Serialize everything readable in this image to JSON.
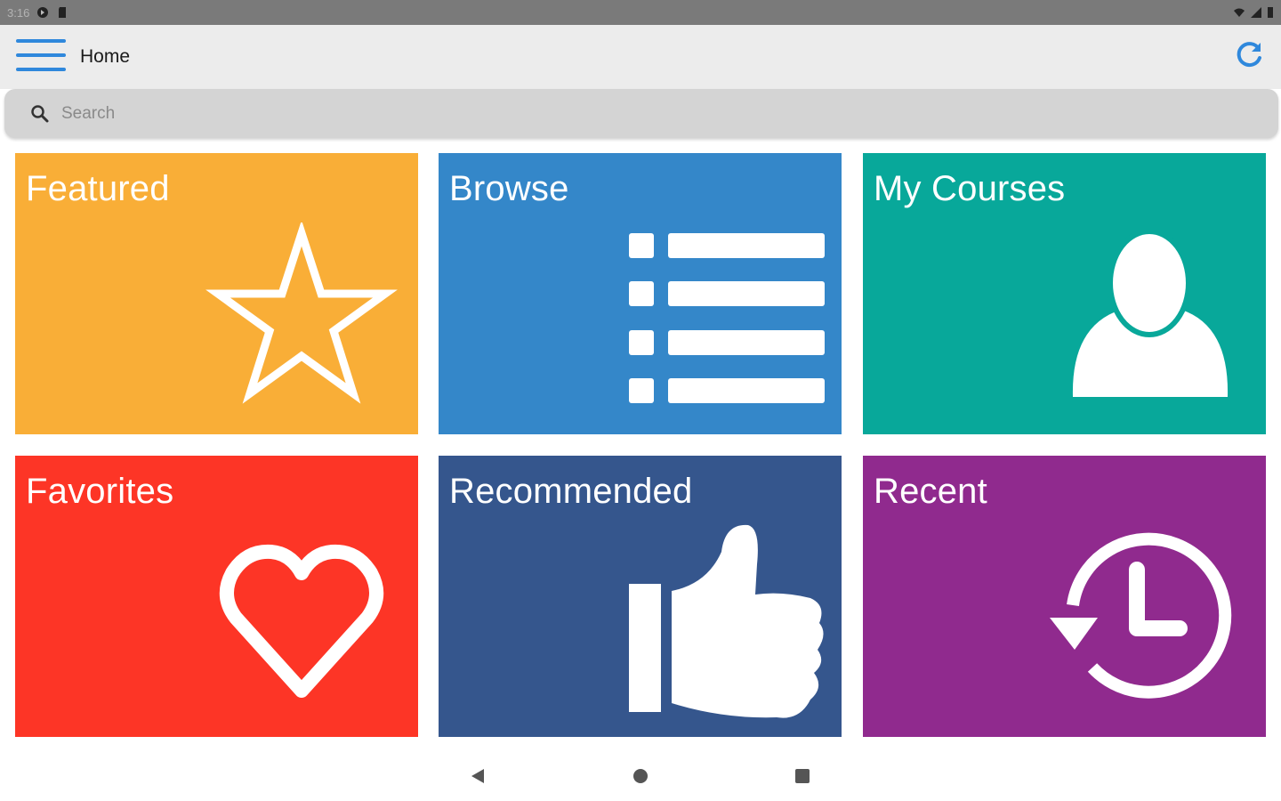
{
  "status_bar": {
    "time": "3:16",
    "icons": [
      "data-saver-icon",
      "sd-card-icon",
      "wifi-icon",
      "signal-icon",
      "battery-icon"
    ]
  },
  "app_bar": {
    "title": "Home",
    "accent_color": "#2f88dc",
    "menu_icon": "hamburger-menu-icon",
    "refresh_icon": "refresh-icon"
  },
  "search": {
    "placeholder": "Search",
    "value": "",
    "icon": "search-icon"
  },
  "tiles": [
    {
      "label": "Featured",
      "color": "#f9ae37",
      "icon": "star-outline-icon"
    },
    {
      "label": "Browse",
      "color": "#3487c9",
      "icon": "list-icon"
    },
    {
      "label": "My Courses",
      "color": "#08a89a",
      "icon": "user-icon"
    },
    {
      "label": "Favorites",
      "color": "#fd3526",
      "icon": "heart-outline-icon"
    },
    {
      "label": "Recommended",
      "color": "#35568d",
      "icon": "thumbs-up-icon"
    },
    {
      "label": "Recent",
      "color": "#902a8e",
      "icon": "history-clock-icon"
    }
  ],
  "nav_bar": {
    "icons": [
      "back-icon",
      "home-icon",
      "recents-icon"
    ]
  }
}
